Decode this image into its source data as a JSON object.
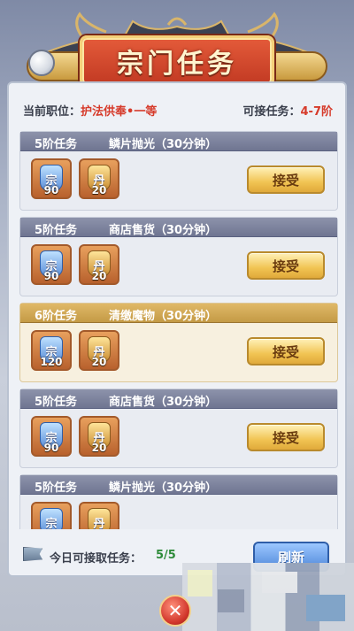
{
  "title": "宗门任务",
  "info": {
    "position_label": "当前职位：",
    "position_value": "护法供奉•一等",
    "range_label": "可接任务：",
    "range_value": "4-7阶"
  },
  "tasks": [
    {
      "tier": "5阶任务",
      "name": "鳞片抛光（30分钟）",
      "style": "normal",
      "rewards": [
        {
          "icon": "sect-badge-icon",
          "count": "90"
        },
        {
          "icon": "scroll-token-icon",
          "count": "20"
        }
      ],
      "accept_label": "接受"
    },
    {
      "tier": "5阶任务",
      "name": "商店售货（30分钟）",
      "style": "normal",
      "rewards": [
        {
          "icon": "sect-badge-icon",
          "count": "90"
        },
        {
          "icon": "scroll-token-icon",
          "count": "20"
        }
      ],
      "accept_label": "接受"
    },
    {
      "tier": "6阶任务",
      "name": "清缴魔物（30分钟）",
      "style": "gold",
      "rewards": [
        {
          "icon": "sect-badge-icon",
          "count": "120"
        },
        {
          "icon": "scroll-token-icon",
          "count": "20"
        }
      ],
      "accept_label": "接受"
    },
    {
      "tier": "5阶任务",
      "name": "商店售货（30分钟）",
      "style": "normal",
      "rewards": [
        {
          "icon": "sect-badge-icon",
          "count": "90"
        },
        {
          "icon": "scroll-token-icon",
          "count": "20"
        }
      ],
      "accept_label": "接受"
    },
    {
      "tier": "5阶任务",
      "name": "鳞片抛光（30分钟）",
      "style": "normal",
      "rewards": [
        {
          "icon": "sect-badge-icon",
          "count": ""
        },
        {
          "icon": "scroll-token-icon",
          "count": ""
        }
      ],
      "accept_label": ""
    }
  ],
  "footer": {
    "label": "今日可接取任务：",
    "count": "5/5",
    "refresh_label": "刷新"
  },
  "colors": {
    "banner": "#c23a23",
    "accept": "#f1c453",
    "refresh": "#4d86d8",
    "highlight": "#d63a2a"
  }
}
